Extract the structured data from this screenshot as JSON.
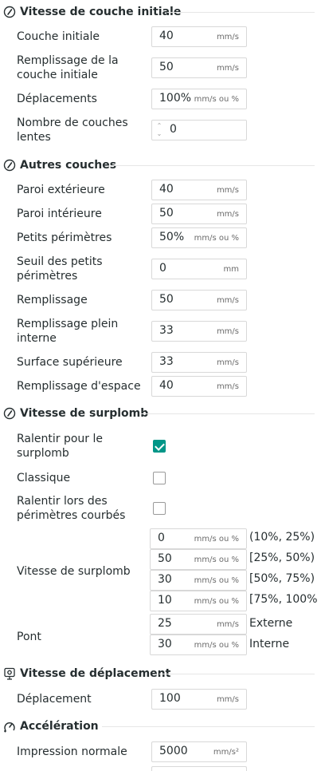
{
  "sections": {
    "initial": {
      "title": "Vitesse de couche initiale"
    },
    "other": {
      "title": "Autres couches"
    },
    "overhang": {
      "title": "Vitesse de surplomb"
    },
    "travel": {
      "title": "Vitesse de déplacement"
    },
    "accel": {
      "title": "Accélération"
    }
  },
  "initial_layer": {
    "first_layer": {
      "label": "Couche initiale",
      "value": "40",
      "unit": "mm/s"
    },
    "first_layer_infill": {
      "label": "Remplissage de la couche initiale",
      "value": "50",
      "unit": "mm/s"
    },
    "travel": {
      "label": "Déplacements",
      "value": "100%",
      "unit": "mm/s ou %"
    },
    "slow_layers": {
      "label": "Nombre de couches lentes",
      "value": "0",
      "up": "⌃",
      "down": "⌄"
    }
  },
  "other_layers": {
    "outer_wall": {
      "label": "Paroi extérieure",
      "value": "40",
      "unit": "mm/s"
    },
    "inner_wall": {
      "label": "Paroi intérieure",
      "value": "50",
      "unit": "mm/s"
    },
    "small_perimeters": {
      "label": "Petits périmètres",
      "value": "50%",
      "unit": "mm/s ou %"
    },
    "small_perimeter_threshold": {
      "label": "Seuil des petits périmètres",
      "value": "0",
      "unit": "mm"
    },
    "infill": {
      "label": "Remplissage",
      "value": "50",
      "unit": "mm/s"
    },
    "internal_solid_infill": {
      "label": "Remplissage plein interne",
      "value": "33",
      "unit": "mm/s"
    },
    "top_surface": {
      "label": "Surface supérieure",
      "value": "33",
      "unit": "mm/s"
    },
    "gap_fill": {
      "label": "Remplissage d'espace",
      "value": "40",
      "unit": "mm/s"
    }
  },
  "overhang": {
    "slow_down": {
      "label": "Ralentir pour le surplomb",
      "checked": true
    },
    "classic": {
      "label": "Classique",
      "checked": false
    },
    "curled": {
      "label": "Ralentir lors des périmètres courbés",
      "checked": false
    },
    "speed_label": "Vitesse de surplomb",
    "speeds": [
      {
        "value": "0",
        "unit": "mm/s ou %",
        "range": "(10%, 25%)"
      },
      {
        "value": "50",
        "unit": "mm/s ou %",
        "range": "[25%, 50%)"
      },
      {
        "value": "30",
        "unit": "mm/s ou %",
        "range": "[50%, 75%)"
      },
      {
        "value": "10",
        "unit": "mm/s ou %",
        "range": "[75%, 100%"
      }
    ],
    "bridge_label": "Pont",
    "bridge": [
      {
        "value": "25",
        "unit": "mm/s",
        "side": "Externe"
      },
      {
        "value": "30",
        "unit": "mm/s ou %",
        "side": "Interne"
      }
    ]
  },
  "travel_speed": {
    "label": "Déplacement",
    "value": "100",
    "unit": "mm/s"
  },
  "acceleration": {
    "normal": {
      "label": "Impression normale",
      "value": "5000",
      "unit": "mm/s²"
    }
  },
  "colors": {
    "accent": "#009688",
    "border": "#d8d8d8",
    "text": "#262e30"
  },
  "icons": {
    "initial": "speedometer-icon",
    "other": "speedometer-icon",
    "overhang": "speedometer-icon",
    "travel": "travel-icon",
    "accel": "acceleration-icon"
  }
}
